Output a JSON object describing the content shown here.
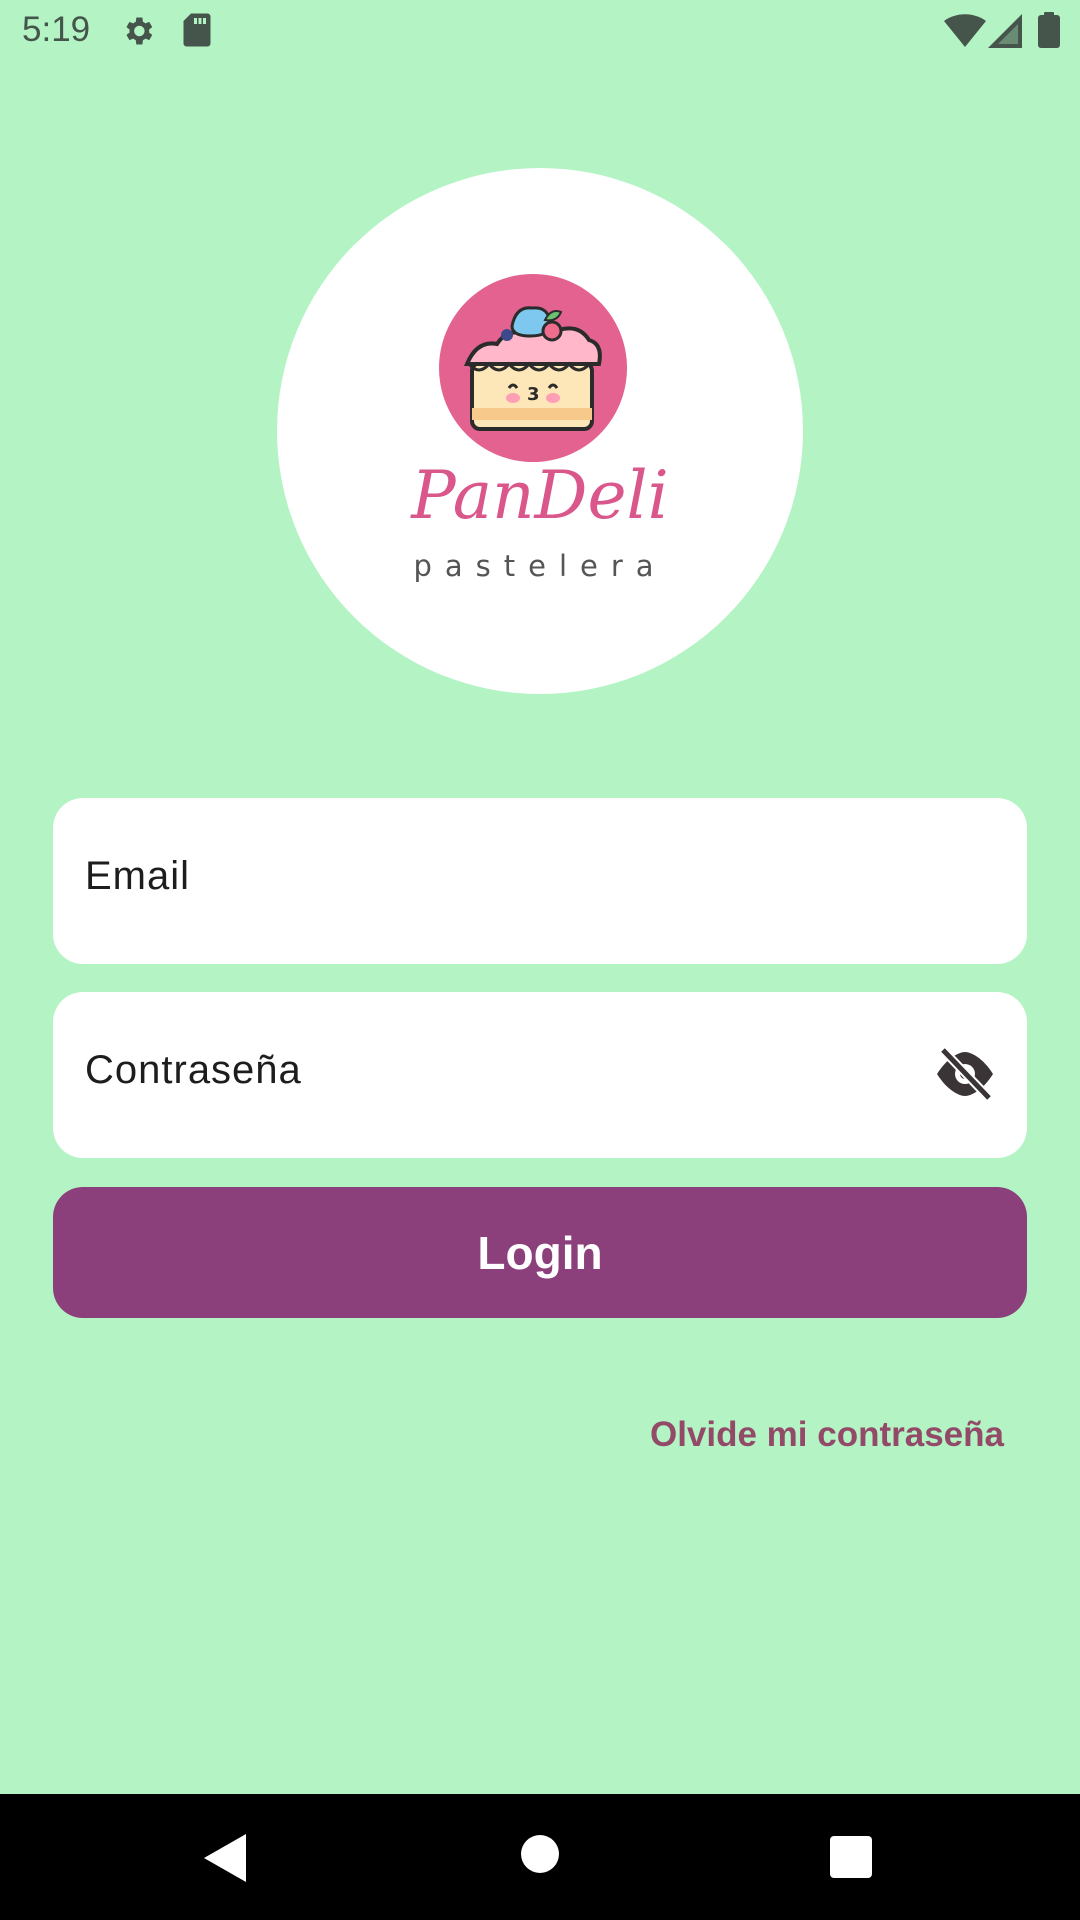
{
  "status_bar": {
    "time": "5:19",
    "icons": [
      "settings-icon",
      "sdcard-icon",
      "wifi-icon",
      "signal-icon",
      "battery-icon"
    ]
  },
  "logo": {
    "brand_script": "PanDeli",
    "brand_subtitle": "pastelera"
  },
  "form": {
    "email_label": "Email",
    "password_label": "Contraseña",
    "visibility_icon": "visibility-off-icon",
    "login_label": "Login",
    "forgot_label": "Olvide mi contraseña"
  },
  "nav_bar": {
    "icons": [
      "back-icon",
      "home-icon",
      "recents-icon"
    ]
  },
  "colors": {
    "background": "#b3f3c4",
    "primary_button": "#8b407c",
    "link": "#924a68",
    "logo_pink": "#e4628f"
  }
}
